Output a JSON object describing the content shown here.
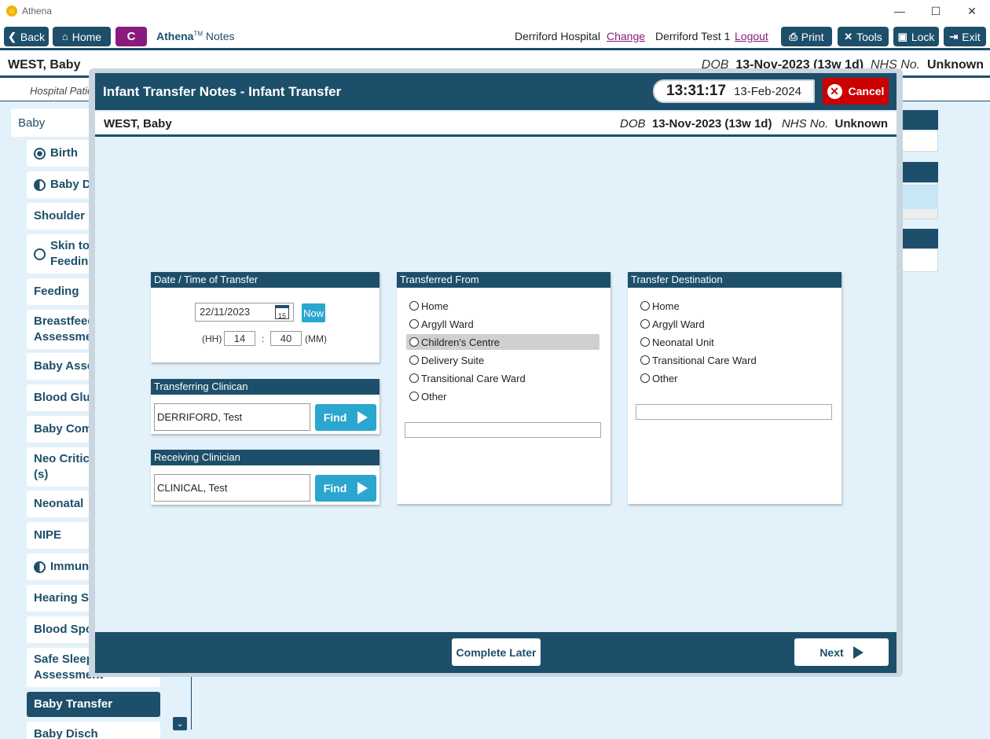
{
  "window": {
    "title": "Athena",
    "minimize": "—",
    "maximize": "☐",
    "close": "✕"
  },
  "toolbar": {
    "back": "Back",
    "home": "Home",
    "c_button": "C",
    "brand_bold": "Athena",
    "brand_tm": "TM",
    "brand_rest": " Notes",
    "hospital": "Derriford Hospital",
    "change": "Change",
    "user": "Derriford Test 1",
    "logout": "Logout",
    "print": "Print",
    "tools": "Tools",
    "lock": "Lock",
    "exit": "Exit"
  },
  "patient": {
    "name": "WEST, Baby",
    "dob_label": "DOB",
    "dob": "13-Nov-2023 (13w 1d)",
    "nhs_label": "NHS No.",
    "nhs": "Unknown"
  },
  "subbar": {
    "text": "Hospital Patie"
  },
  "sidebar": {
    "heading": "Baby",
    "items": [
      {
        "label": "Birth"
      },
      {
        "label": "Baby Det"
      },
      {
        "label": "Shoulder D"
      },
      {
        "label": "Skin to S",
        "label2": "Feeding"
      },
      {
        "label": "Feeding"
      },
      {
        "label": "Breastfeedi",
        "label2": "Assessmen"
      },
      {
        "label": "Baby Asses"
      },
      {
        "label": "Blood Gluc"
      },
      {
        "label": "Baby Comm"
      },
      {
        "label": "Neo Critica",
        "label2": "(s)"
      },
      {
        "label": "Neonatal"
      },
      {
        "label": "NIPE"
      },
      {
        "label": "Immunis"
      },
      {
        "label": "Hearing Sc"
      },
      {
        "label": "Blood Spot"
      },
      {
        "label": "Safe Sleepi",
        "label2": "Assessment"
      },
      {
        "label": "Baby Transfer"
      },
      {
        "label": "Baby Disch"
      }
    ]
  },
  "modal": {
    "title": "Infant Transfer Notes - Infant Transfer",
    "time": "13:31:17",
    "date": "13-Feb-2024",
    "cancel": "Cancel",
    "complete_later": "Complete Later",
    "next": "Next"
  },
  "datetime_panel": {
    "header": "Date / Time of Transfer",
    "date_value": "22/11/2023",
    "cal_day": "15",
    "now": "Now",
    "hh_label": "(HH)",
    "hh": "14",
    "sep": ":",
    "mm": "40",
    "mm_label": "(MM)"
  },
  "transferring": {
    "header": "Transferring Clinican",
    "value": "DERRIFORD, Test",
    "find": "Find"
  },
  "receiving": {
    "header": "Receiving Clinician",
    "value": "CLINICAL, Test",
    "find": "Find"
  },
  "from_panel": {
    "header": "Transferred From",
    "options": [
      "Home",
      "Argyll Ward",
      "Children's Centre",
      "Delivery Suite",
      "Transitional Care Ward",
      "Other"
    ],
    "highlighted": "Children's Centre"
  },
  "dest_panel": {
    "header": "Transfer Destination",
    "options": [
      "Home",
      "Argyll Ward",
      "Neonatal Unit",
      "Transitional Care Ward",
      "Other"
    ]
  },
  "colors": {
    "primary": "#1d4f6b",
    "accent": "#2aa6cf",
    "purple": "#8a1a7d",
    "cancel": "#cc0000",
    "background": "#e3f1fb"
  }
}
